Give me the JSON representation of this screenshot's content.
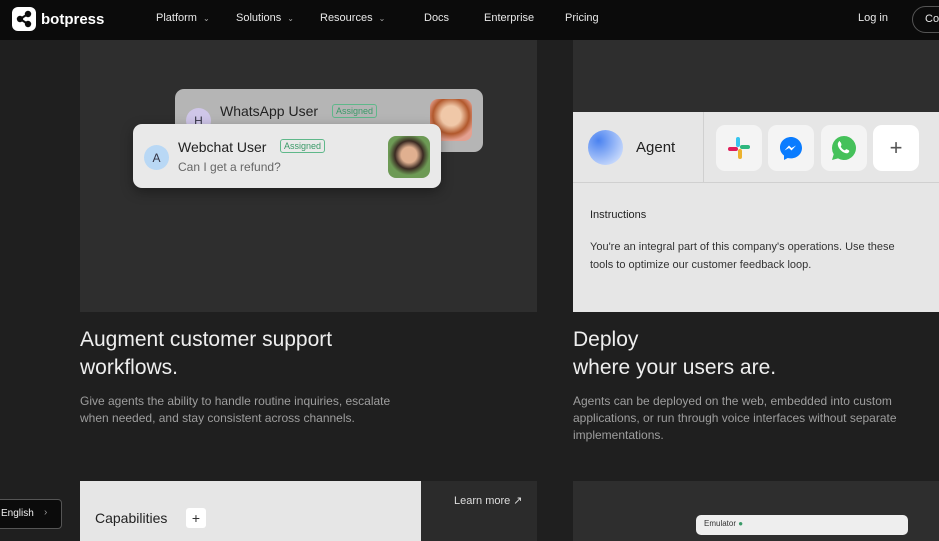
{
  "nav": {
    "brand": "botpress",
    "items": [
      {
        "label": "Platform",
        "dropdown": true
      },
      {
        "label": "Solutions",
        "dropdown": true
      },
      {
        "label": "Resources",
        "dropdown": true
      },
      {
        "label": "Docs"
      },
      {
        "label": "Enterprise"
      },
      {
        "label": "Pricing"
      }
    ],
    "login": "Log in",
    "contact": "Co"
  },
  "left_card": {
    "chats": [
      {
        "initial": "H",
        "name": "WhatsApp User",
        "badge": "Assigned"
      },
      {
        "initial": "A",
        "name": "Webchat User",
        "badge": "Assigned",
        "message": "Can I get a refund?"
      }
    ],
    "title_line1": "Augment customer support",
    "title_line2": "workflows.",
    "description": "Give agents the ability to handle routine inquiries, escalate when needed, and stay consistent across channels."
  },
  "right_card": {
    "agent_label": "Agent",
    "channels": [
      "slack-icon",
      "messenger-icon",
      "whatsapp-icon",
      "plus-icon"
    ],
    "instructions_title": "Instructions",
    "instructions_body": "You're an integral part of this company's operations. Use these tools to optimize our customer feedback loop.",
    "title_line1": "Deploy",
    "title_line2": "where your users are.",
    "description": "Agents can be deployed on the web, embedded into custom applications, or run through voice interfaces without separate implementations."
  },
  "bottom": {
    "capabilities": "Capabilities",
    "plus": "+",
    "learn_more": "Learn more ↗",
    "emulator": "Emulator"
  },
  "language": {
    "label": "English"
  }
}
